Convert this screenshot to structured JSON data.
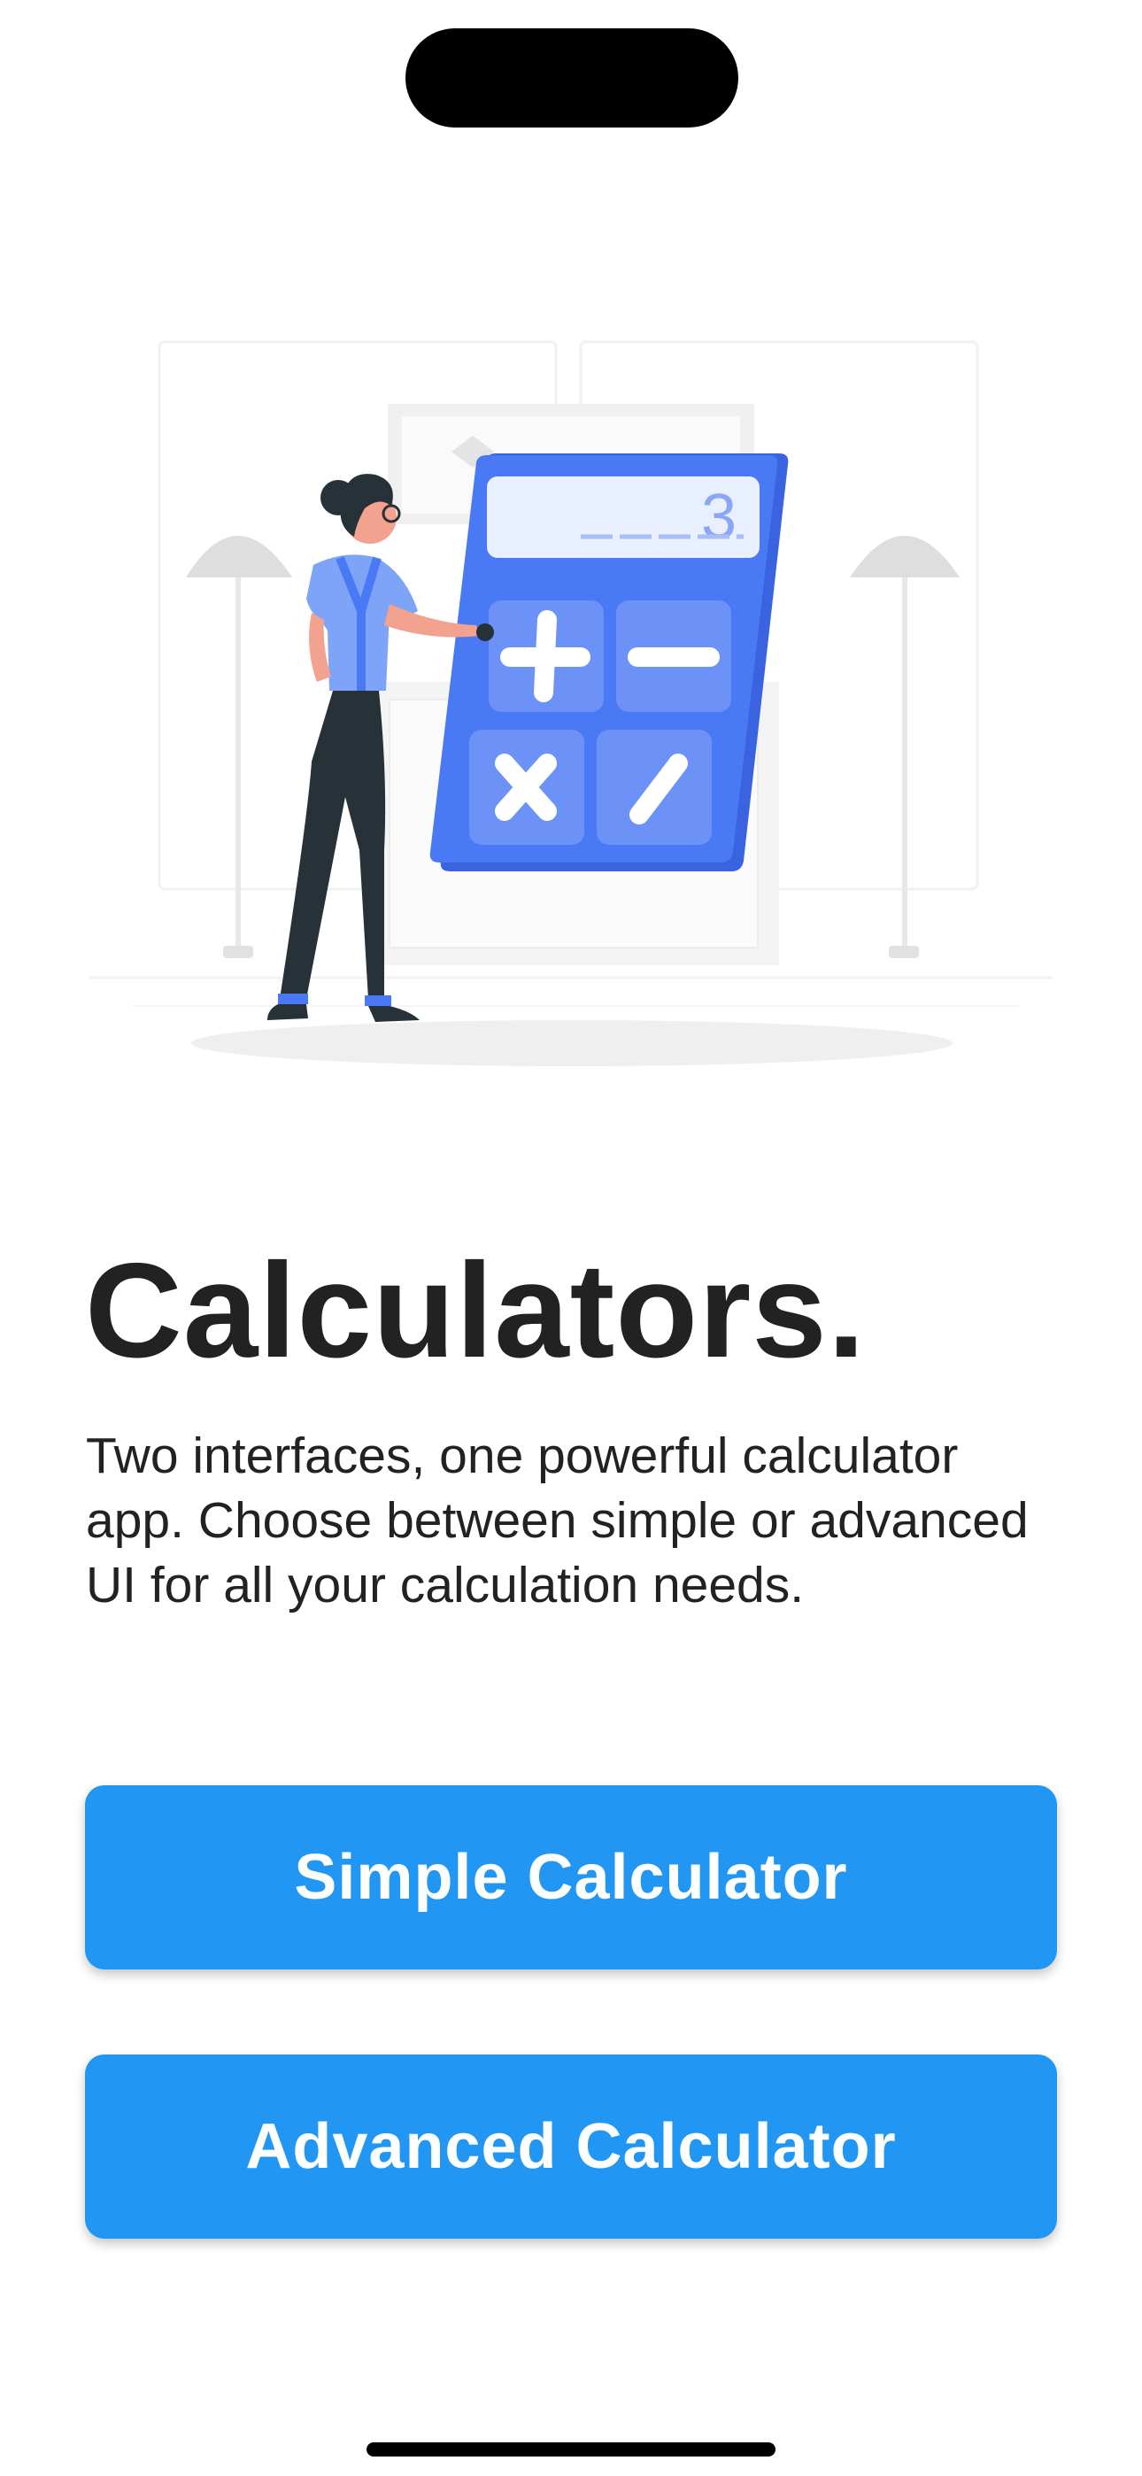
{
  "welcome": {
    "title": "Calculators.",
    "description": "Two interfaces, one powerful calculator app. Choose between simple or advanced UI for all your calculation needs.",
    "illustration": {
      "icon": "person-with-calculator-illustration",
      "display_digit": "3",
      "key_symbols": [
        "+",
        "−",
        "×",
        "/"
      ]
    }
  },
  "actions": {
    "simple_label": "Simple Calculator",
    "advanced_label": "Advanced Calculator"
  },
  "colors": {
    "accent": "#2196F3",
    "calculator_blue": "#4A79F5",
    "text": "#222222",
    "background": "#FFFFFF"
  }
}
